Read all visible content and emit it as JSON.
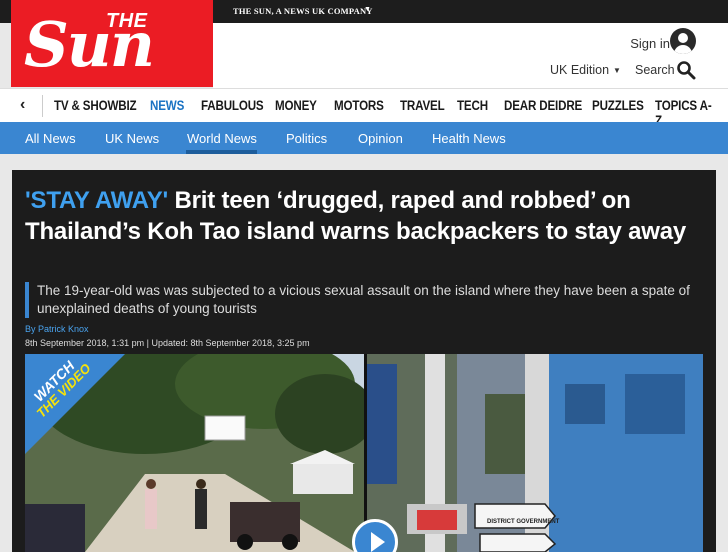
{
  "top_bar": {
    "company_label": "THE SUN, A NEWS UK COMPANY"
  },
  "logo": {
    "the": "THE",
    "sun": "Sun"
  },
  "header": {
    "sign_in": "Sign in",
    "edition": "UK Edition",
    "search": "Search"
  },
  "nav": {
    "items": [
      "TV & SHOWBIZ",
      "NEWS",
      "FABULOUS",
      "MONEY",
      "MOTORS",
      "TRAVEL",
      "TECH",
      "DEAR DEIDRE",
      "PUZZLES",
      "TOPICS A-Z"
    ],
    "active": "NEWS"
  },
  "subnav": {
    "items": [
      "All News",
      "UK News",
      "World News",
      "Politics",
      "Opinion",
      "Health News"
    ],
    "active": "World News"
  },
  "article": {
    "kicker": "'STAY AWAY'",
    "headline": "Brit teen ‘drugged, raped and robbed’ on Thailand’s Koh Tao island warns backpackers to stay away",
    "standfirst": "The 19-year-old was was subjected to a vicious sexual assault on the island where they have been a spate of unexplained deaths of young tourists",
    "byline": "By Patrick Knox",
    "published": "8th September 2018, 1:31 pm",
    "updated": "Updated: 8th September 2018, 3:25 pm"
  },
  "video": {
    "badge_line1": "WATCH",
    "badge_line2": "THE VIDEO",
    "sign_line1": "DISTRICT GOVERNMENT"
  },
  "colors": {
    "brand_red": "#eb1c24",
    "nav_blue": "#3a86d1",
    "kicker_blue": "#3fa0ef"
  }
}
